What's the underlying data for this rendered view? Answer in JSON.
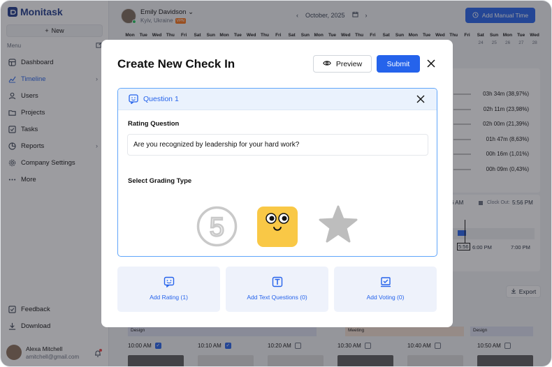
{
  "app": {
    "logo_text": "Monitask",
    "new_label": "New",
    "menu_label": "Menu"
  },
  "nav": [
    {
      "label": "Dashboard",
      "icon": "dashboard-icon"
    },
    {
      "label": "Timeline",
      "icon": "timeline-icon",
      "active": true,
      "chevron": true
    },
    {
      "label": "Users",
      "icon": "users-icon"
    },
    {
      "label": "Projects",
      "icon": "folder-icon"
    },
    {
      "label": "Tasks",
      "icon": "tasks-icon"
    },
    {
      "label": "Reports",
      "icon": "reports-icon",
      "chevron": true
    },
    {
      "label": "Company Settings",
      "icon": "gear-icon"
    },
    {
      "label": "More",
      "icon": "more-icon"
    }
  ],
  "bottom_nav": [
    {
      "label": "Feedback",
      "icon": "feedback-icon"
    },
    {
      "label": "Download",
      "icon": "download-icon"
    }
  ],
  "current_user": {
    "name": "Alexa Mitchell",
    "email": "amitchell@gmail.com"
  },
  "employee": {
    "name": "Emily Davidson",
    "location": "Kyiv, Ukraine",
    "badge": "VPN"
  },
  "date_nav": {
    "label": "October, 2025"
  },
  "manual_time_label": "Add Manual Time",
  "days": [
    "Mon",
    "Tue",
    "Wed",
    "Thu",
    "Fri",
    "Sat",
    "Sun",
    "Mon",
    "Tue",
    "Wed",
    "Thu",
    "Fri",
    "Sat",
    "Sun",
    "Mon",
    "Tue",
    "Wed",
    "Thu",
    "Fri",
    "Sat",
    "Sun",
    "Mon",
    "Tue",
    "Wed",
    "Thu",
    "Fri",
    "Sat",
    "Sun",
    "Mon",
    "Tue",
    "Wed"
  ],
  "day_numbers_visible": [
    "24",
    "25",
    "26",
    "27",
    "28"
  ],
  "stats": [
    "03h 34m (38,97%)",
    "02h 11m (23,98%)",
    "02h 00m (21,39%)",
    "01h 47m (8,63%)",
    "00h 16m (1,01%)",
    "00h 09m (0,43%)"
  ],
  "clock": {
    "clock_in_time": "6 AM",
    "clock_out_label": "Clock Out:",
    "clock_out_time": "5:56 PM",
    "marker": "5:56",
    "t1": "6:00 PM",
    "t2": "7:00 PM"
  },
  "export_label": "Export",
  "tracks": [
    "Design",
    "Meeting",
    "Design"
  ],
  "slots": [
    {
      "time": "10:00 AM",
      "checked": true
    },
    {
      "time": "10:10 AM",
      "checked": true
    },
    {
      "time": "10:20 AM",
      "checked": false
    },
    {
      "time": "10:30 AM",
      "checked": false
    },
    {
      "time": "10:40 AM",
      "checked": false
    },
    {
      "time": "10:50 AM",
      "checked": false
    }
  ],
  "modal": {
    "title": "Create New Check In",
    "preview_label": "Preview",
    "submit_label": "Submit",
    "question": {
      "header": "Question 1",
      "rating_label": "Rating Question",
      "rating_value": "Are you recognized by leadership for your hard work?",
      "grading_label": "Select Grading Type",
      "grading_number": "5"
    },
    "add_cards": [
      {
        "label": "Add Rating (1)",
        "icon": "rating-icon"
      },
      {
        "label": "Add Text Questions (0)",
        "icon": "text-icon"
      },
      {
        "label": "Add Voting (0)",
        "icon": "voting-icon"
      }
    ]
  },
  "colors": {
    "accent": "#2563eb",
    "emoji_yellow": "#f9c846",
    "question_header_bg": "#eaf2fd"
  }
}
